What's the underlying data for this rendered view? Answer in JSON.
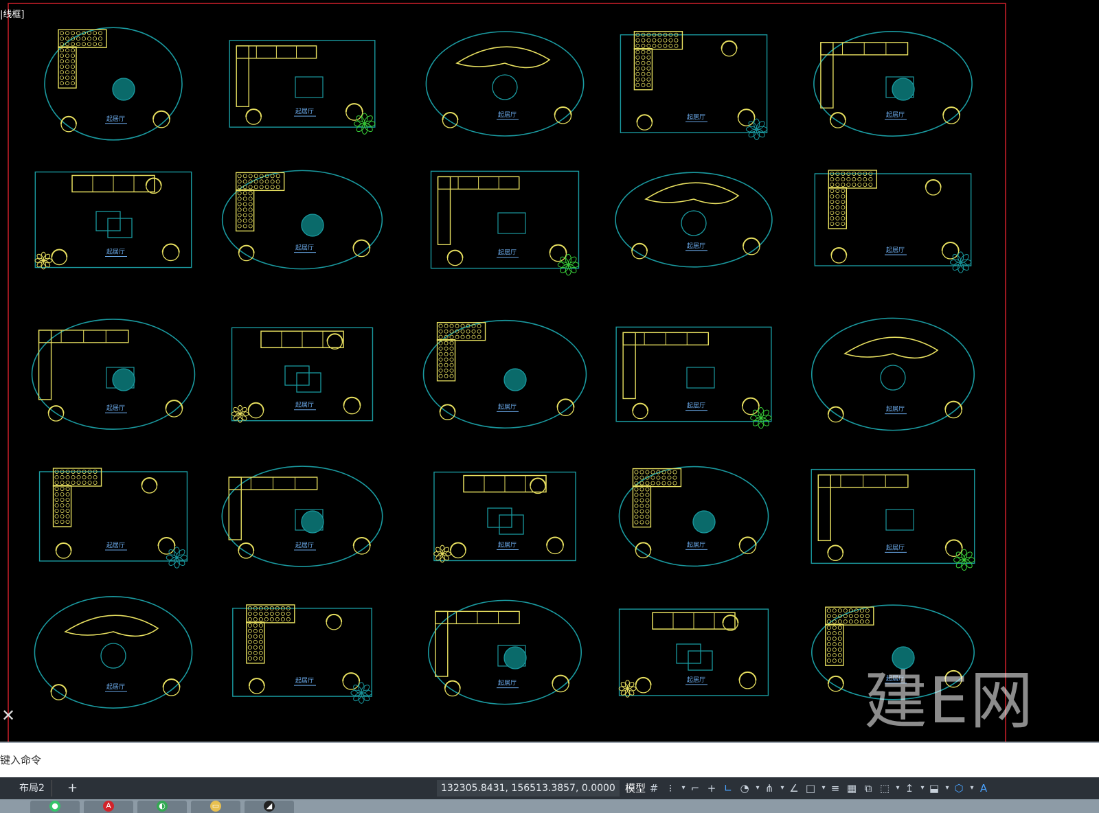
{
  "viewport": {
    "label": "[-][俯视][二维线框]",
    "label_visible": "|线框]",
    "frame_color": "#d0202a",
    "watermark": "建E网",
    "block_label": "起居厅",
    "colors": {
      "furniture": "#e8e060",
      "outline": "#1a9aa0",
      "plant": "#3ad23a",
      "label": "#6aa8e8"
    }
  },
  "command_line": {
    "prompt": "键入命令"
  },
  "status_bar": {
    "tabs": [
      {
        "label": "布局2"
      },
      {
        "label": "+"
      }
    ],
    "coordinates": "132305.8431, 156513.3857, 0.0000",
    "model_label": "模型",
    "toggles": [
      {
        "name": "grid-icon",
        "glyph": "#",
        "on": false
      },
      {
        "name": "snap-icon",
        "glyph": "⁝",
        "on": false
      },
      {
        "name": "infer-icon",
        "glyph": "⌐",
        "on": false
      },
      {
        "name": "dynamic-input-icon",
        "glyph": "+",
        "on": false
      },
      {
        "name": "ortho-icon",
        "glyph": "∟",
        "on": true
      },
      {
        "name": "polar-icon",
        "glyph": "◔",
        "on": false
      },
      {
        "name": "isodraft-icon",
        "glyph": "⋔",
        "on": false
      },
      {
        "name": "object-snap-tracking-icon",
        "glyph": "∠",
        "on": false
      },
      {
        "name": "object-snap-icon",
        "glyph": "□",
        "on": false
      },
      {
        "name": "lineweight-icon",
        "glyph": "≡",
        "on": false
      },
      {
        "name": "transparency-icon",
        "glyph": "▦",
        "on": false
      },
      {
        "name": "selection-cycling-icon",
        "glyph": "⧉",
        "on": false
      },
      {
        "name": "3d-osnap-icon",
        "glyph": "⬚",
        "on": false
      },
      {
        "name": "ucs-icon",
        "glyph": "↥",
        "on": false
      },
      {
        "name": "annotation-monitor-icon",
        "glyph": "⬓",
        "on": false
      },
      {
        "name": "units-icon",
        "glyph": "⬡",
        "on": true
      },
      {
        "name": "annotation-scale-icon",
        "glyph": "A",
        "on": true
      }
    ]
  },
  "taskbar": {
    "apps": [
      {
        "name": "wechat-taskbar-icon",
        "color": "#35c46a",
        "glyph": "●"
      },
      {
        "name": "autocad-taskbar-icon",
        "color": "#d2232a",
        "glyph": "A"
      },
      {
        "name": "browser-taskbar-icon",
        "color": "#34a853",
        "glyph": "◐"
      },
      {
        "name": "folder-taskbar-icon",
        "color": "#e8c050",
        "glyph": "▭"
      },
      {
        "name": "app5-taskbar-icon",
        "color": "#222",
        "glyph": "◢"
      }
    ]
  }
}
